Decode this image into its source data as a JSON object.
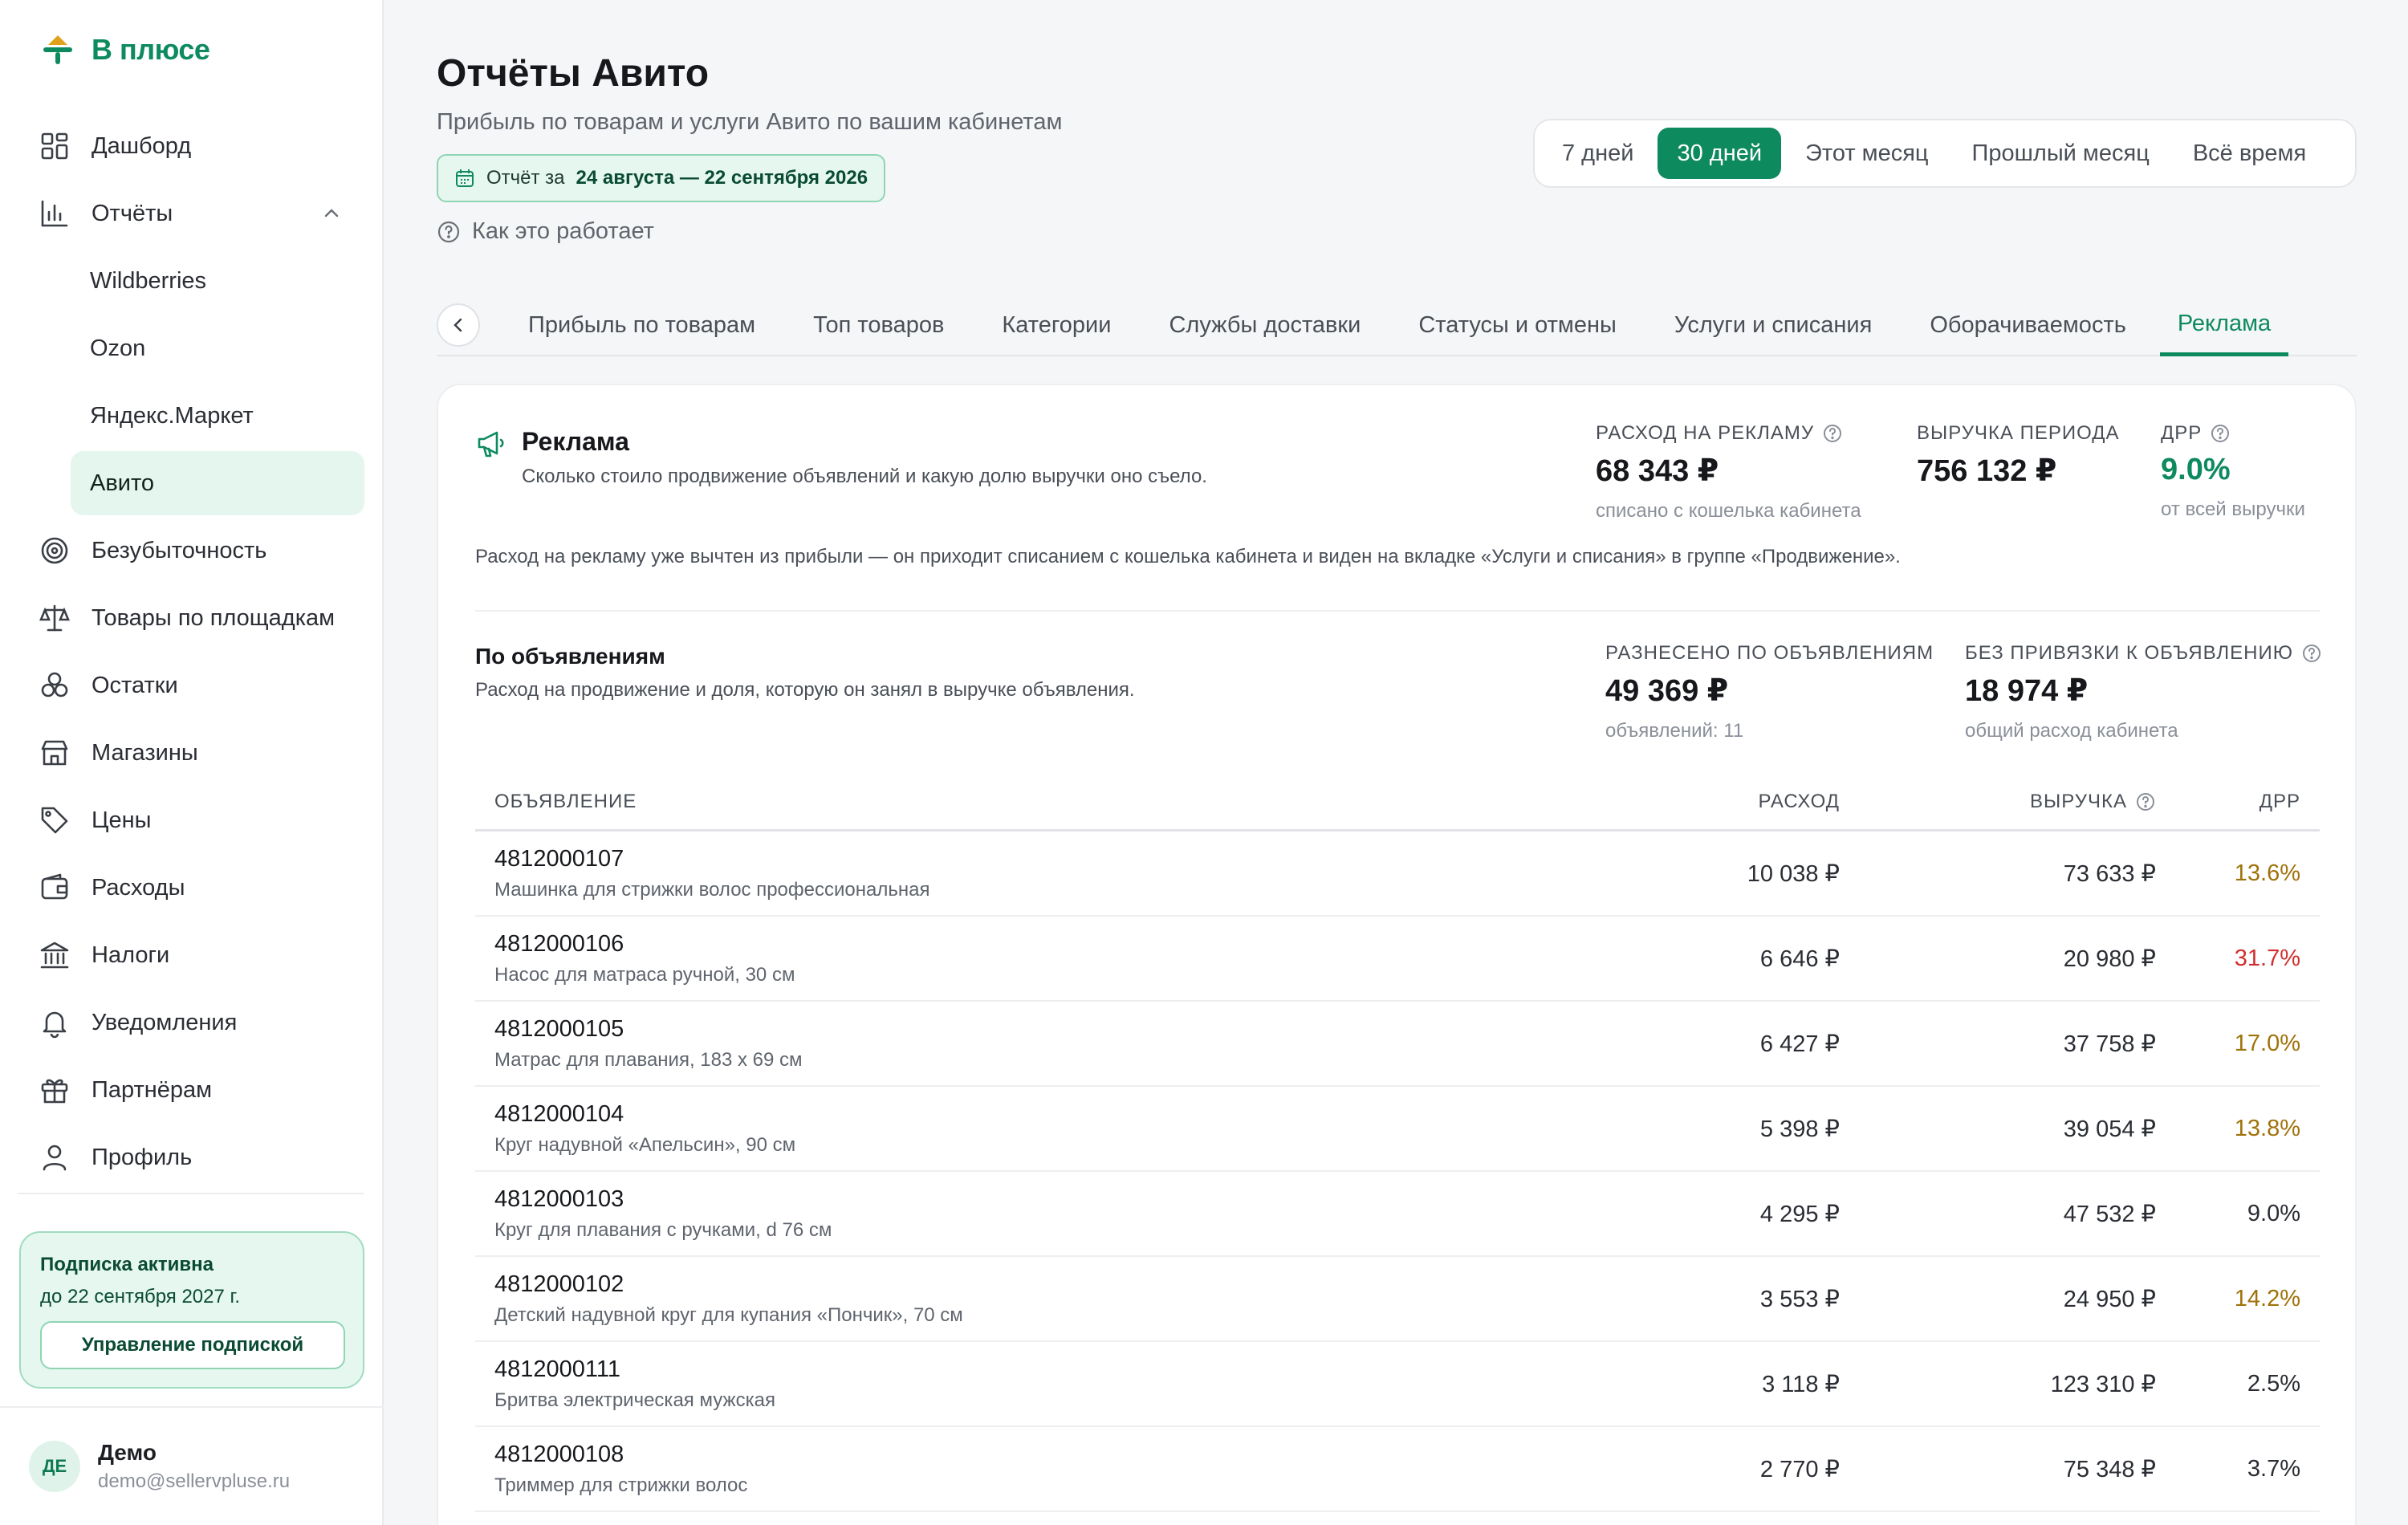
{
  "brand": {
    "name": "В плюсе",
    "accent": "#0e8a5f"
  },
  "sidebar": {
    "items": [
      {
        "label": "Дашборд",
        "icon": "dashboard-icon"
      },
      {
        "label": "Отчёты",
        "icon": "chart-icon",
        "expanded": true
      },
      {
        "label": "Безубыточность",
        "icon": "target-icon"
      },
      {
        "label": "Товары по площадкам",
        "icon": "scales-icon"
      },
      {
        "label": "Остатки",
        "icon": "stock-icon"
      },
      {
        "label": "Магазины",
        "icon": "store-icon"
      },
      {
        "label": "Цены",
        "icon": "tag-icon"
      },
      {
        "label": "Расходы",
        "icon": "wallet-icon"
      },
      {
        "label": "Налоги",
        "icon": "bank-icon"
      },
      {
        "label": "Уведомления",
        "icon": "bell-icon"
      },
      {
        "label": "Партнёрам",
        "icon": "gift-icon"
      },
      {
        "label": "Профиль",
        "icon": "user-icon"
      }
    ],
    "report_subitems": [
      "Wildberries",
      "Ozon",
      "Яндекс.Маркет",
      "Авито"
    ],
    "active_subitem": "Авито"
  },
  "subscription": {
    "title": "Подписка активна",
    "until": "до 22 сентября 2027 г.",
    "button": "Управление подпиской"
  },
  "user": {
    "initials": "ДЕ",
    "name": "Демо",
    "email": "demo@sellervpluse.ru"
  },
  "header": {
    "title": "Отчёты Авито",
    "subtitle": "Прибыль по товарам и услуги Авито по вашим кабинетам",
    "report_prefix": "Отчёт за",
    "report_range": "24 августа — 22 сентября 2026",
    "how_it_works": "Как это работает"
  },
  "period": {
    "options": [
      "7 дней",
      "30 дней",
      "Этот месяц",
      "Прошлый месяц",
      "Всё время"
    ],
    "selected": "30 дней"
  },
  "tabs": [
    "Прибыль по товарам",
    "Топ товаров",
    "Категории",
    "Службы доставки",
    "Статусы и отмены",
    "Услуги и списания",
    "Оборачиваемость",
    "Реклама"
  ],
  "active_tab": "Реклама",
  "ads": {
    "title": "Реклама",
    "description": "Сколько стоило продвижение объявлений и какую долю выручки оно съело.",
    "spend_label": "РАСХОД НА РЕКЛАМУ",
    "spend_value": "68 343 ₽",
    "spend_note": "списано с кошелька кабинета",
    "revenue_label": "ВЫРУЧКА ПЕРИОДА",
    "revenue_value": "756 132 ₽",
    "drr_label": "ДРР",
    "drr_value": "9.0%",
    "drr_note": "от всей выручки",
    "info": "Расход на рекламу уже вычтен из прибыли — он приходит списанием с кошелька кабинета и виден на вкладке «Услуги и списания» в группе «Продвижение»."
  },
  "by_ads": {
    "title": "По объявлениям",
    "description": "Расход на продвижение и доля, которую он занял в выручке объявления.",
    "allocated_label": "РАЗНЕСЕНО ПО ОБЪЯВЛЕНИЯМ",
    "allocated_value": "49 369 ₽",
    "allocated_note": "объявлений: 11",
    "unlinked_label": "БЕЗ ПРИВЯЗКИ К ОБЪЯВЛЕНИЮ",
    "unlinked_value": "18 974 ₽",
    "unlinked_note": "общий расход кабинета",
    "columns": {
      "ad": "ОБЪЯВЛЕНИЕ",
      "spend": "РАСХОД",
      "revenue": "ВЫРУЧКА",
      "drr": "ДРР"
    },
    "rows": [
      {
        "id": "4812000107",
        "name": "Машинка для стрижки волос профессиональная",
        "spend": "10 038 ₽",
        "revenue": "73 633 ₽",
        "drr": "13.6%",
        "level": "amber"
      },
      {
        "id": "4812000106",
        "name": "Насос для матраса ручной, 30 см",
        "spend": "6 646 ₽",
        "revenue": "20 980 ₽",
        "drr": "31.7%",
        "level": "red"
      },
      {
        "id": "4812000105",
        "name": "Матрас для плавания, 183 х 69 см",
        "spend": "6 427 ₽",
        "revenue": "37 758 ₽",
        "drr": "17.0%",
        "level": "amber"
      },
      {
        "id": "4812000104",
        "name": "Круг надувной «Апельсин», 90 см",
        "spend": "5 398 ₽",
        "revenue": "39 054 ₽",
        "drr": "13.8%",
        "level": "amber"
      },
      {
        "id": "4812000103",
        "name": "Круг для плавания с ручками, d 76 см",
        "spend": "4 295 ₽",
        "revenue": "47 532 ₽",
        "drr": "9.0%",
        "level": "plain"
      },
      {
        "id": "4812000102",
        "name": "Детский надувной круг для купания «Пончик», 70 см",
        "spend": "3 553 ₽",
        "revenue": "24 950 ₽",
        "drr": "14.2%",
        "level": "amber"
      },
      {
        "id": "4812000111",
        "name": "Бритва электрическая мужская",
        "spend": "3 118 ₽",
        "revenue": "123 310 ₽",
        "drr": "2.5%",
        "level": "plain"
      },
      {
        "id": "4812000108",
        "name": "Триммер для стрижки волос",
        "spend": "2 770 ₽",
        "revenue": "75 348 ₽",
        "drr": "3.7%",
        "level": "plain"
      }
    ]
  }
}
